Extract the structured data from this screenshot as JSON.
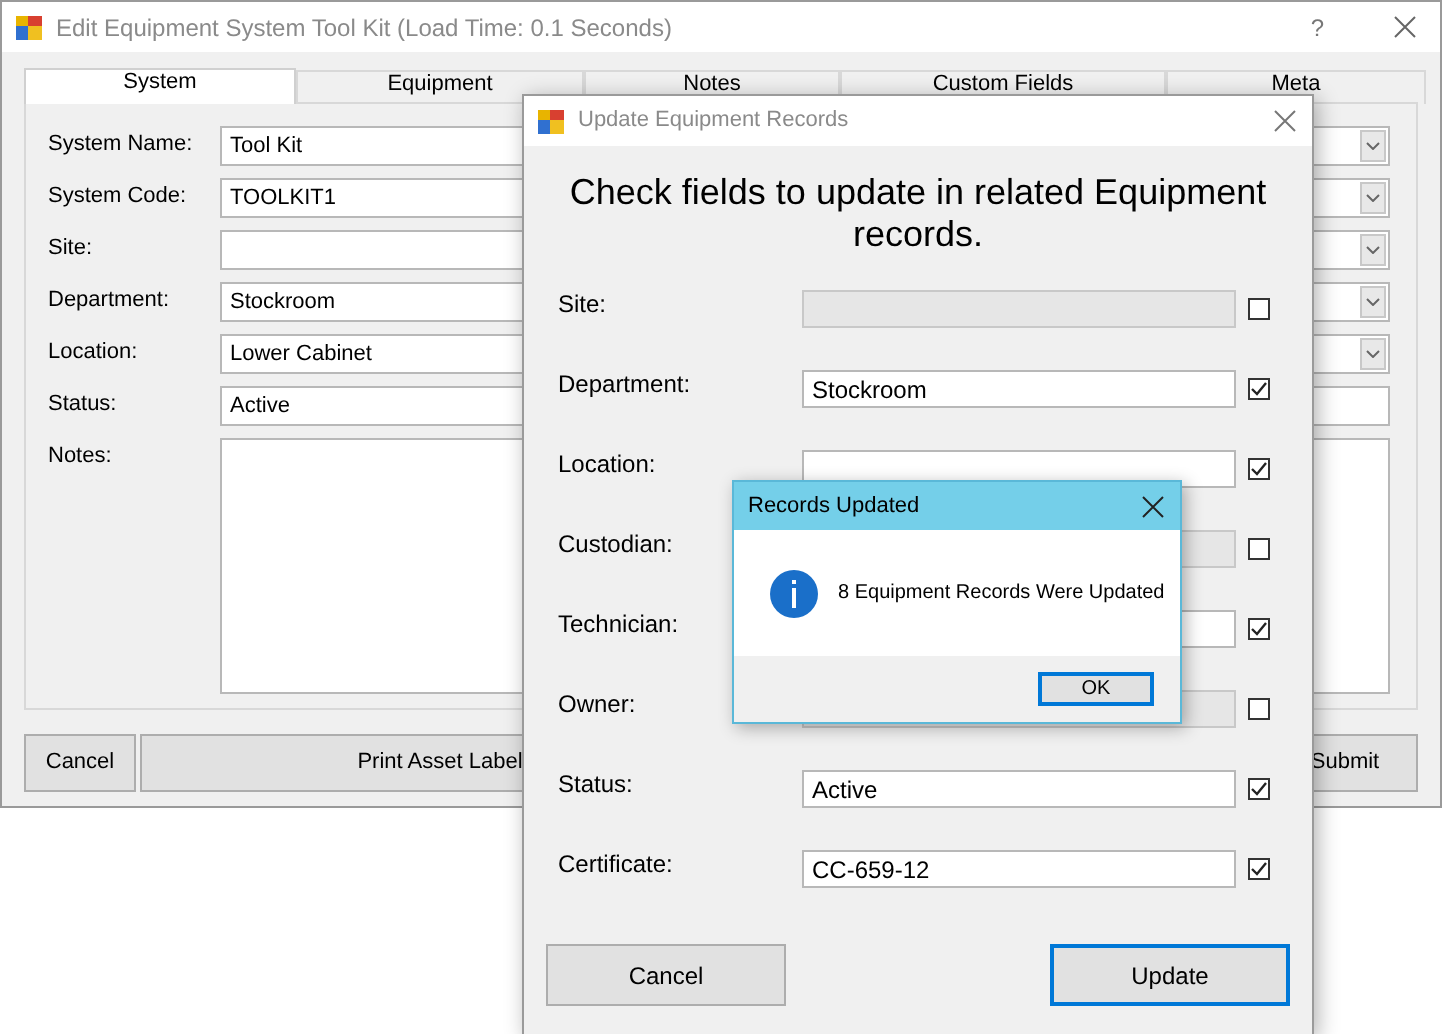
{
  "main_window": {
    "title": "Edit Equipment System Tool Kit (Load Time: 0.1 Seconds)",
    "help": "?",
    "tabs": [
      {
        "label": "System",
        "selected": true
      },
      {
        "label": "Equipment",
        "selected": false
      },
      {
        "label": "Notes",
        "selected": false
      },
      {
        "label": "Custom Fields",
        "selected": false
      },
      {
        "label": "Meta",
        "selected": false
      }
    ],
    "fields": [
      {
        "label": "System Name:",
        "value": "Tool Kit",
        "kind": "combo"
      },
      {
        "label": "System Code:",
        "value": "TOOLKIT1",
        "kind": "combo"
      },
      {
        "label": "Site:",
        "kind": "combo"
      },
      {
        "label": "Department:",
        "value": "Stockroom",
        "kind": "combo"
      },
      {
        "label": "Location:",
        "value": "Lower Cabinet",
        "kind": "combo"
      },
      {
        "label": "Status:",
        "value": "Active",
        "kind": "text"
      },
      {
        "label": "Notes:",
        "kind": "memo"
      }
    ],
    "buttons": [
      {
        "label": "Cancel",
        "kind": "left"
      },
      {
        "label": "Print Asset Label",
        "kind": "wide"
      },
      {
        "label": "Submit",
        "kind": "right"
      }
    ]
  },
  "update_dialog": {
    "title": "Update Equipment Records",
    "heading": "Check fields to update in related Equipment records.",
    "fields": [
      {
        "label": "Site:",
        "checked": false,
        "disabled": true
      },
      {
        "label": "Department:",
        "value": "Stockroom",
        "checked": true,
        "disabled": false
      },
      {
        "label": "Location:",
        "checked": true,
        "disabled": false
      },
      {
        "label": "Custodian:",
        "checked": false,
        "disabled": true
      },
      {
        "label": "Technician:",
        "checked": true,
        "disabled": false
      },
      {
        "label": "Owner:",
        "checked": false,
        "disabled": true
      },
      {
        "label": "Status:",
        "value": "Active",
        "checked": true,
        "disabled": false
      },
      {
        "label": "Certificate:",
        "value": "CC-659-12",
        "checked": true,
        "disabled": false
      }
    ],
    "buttons": [
      {
        "label": "Cancel",
        "default": false
      },
      {
        "label": "Update",
        "default": true
      }
    ]
  },
  "message_box": {
    "title": "Records Updated",
    "message": "8 Equipment Records Were Updated",
    "button": "OK"
  }
}
